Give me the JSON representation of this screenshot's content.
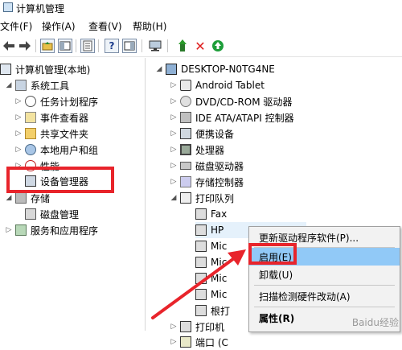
{
  "window": {
    "title": "计算机管理"
  },
  "menubar": [
    "文件(F)",
    "操作(A)",
    "查看(V)",
    "帮助(H)"
  ],
  "toolbar": {
    "buttons": [
      "back-icon",
      "forward-icon",
      "up-folder-icon",
      "console-tree-icon",
      "properties-icon",
      "help-icon",
      "action-pane-icon",
      "computer-icon",
      "update-driver-icon",
      "uninstall-icon",
      "scan-icon"
    ],
    "colors": {
      "uninstall": "#e02020",
      "scan": "#1e9e3a"
    }
  },
  "left_tree": [
    {
      "label": "计算机管理(本地)",
      "icon": "monitor"
    },
    {
      "label": "系统工具",
      "icon": "tool"
    },
    {
      "label": "任务计划程序",
      "icon": "clock"
    },
    {
      "label": "事件查看器",
      "icon": "event"
    },
    {
      "label": "共享文件夹",
      "icon": "folder"
    },
    {
      "label": "本地用户和组",
      "icon": "users"
    },
    {
      "label": "性能",
      "icon": "perf"
    },
    {
      "label": "设备管理器",
      "icon": "dev",
      "selected": true
    },
    {
      "label": "存储",
      "icon": "storage"
    },
    {
      "label": "磁盘管理",
      "icon": "disk"
    },
    {
      "label": "服务和应用程序",
      "icon": "service"
    }
  ],
  "right_tree": {
    "root": "DESKTOP-N0TG4NE",
    "items": [
      "Android Tablet",
      "DVD/CD-ROM 驱动器",
      "IDE ATA/ATAPI 控制器",
      "便携设备",
      "处理器",
      "磁盘驱动器",
      "存储控制器",
      "打印队列",
      "Fax",
      "HP",
      "Mic",
      "Mic",
      "Mic",
      "Mic",
      "根打",
      "打印机",
      "端口 (C"
    ]
  },
  "context_menu": {
    "items": [
      "更新驱动程序软件(P)...",
      "启用(E)",
      "卸载(U)",
      "扫描检测硬件改动(A)",
      "属性(R)"
    ],
    "active_index": 1
  },
  "annotation": {
    "color": "#e8242b"
  },
  "watermark": "Baidu经验"
}
